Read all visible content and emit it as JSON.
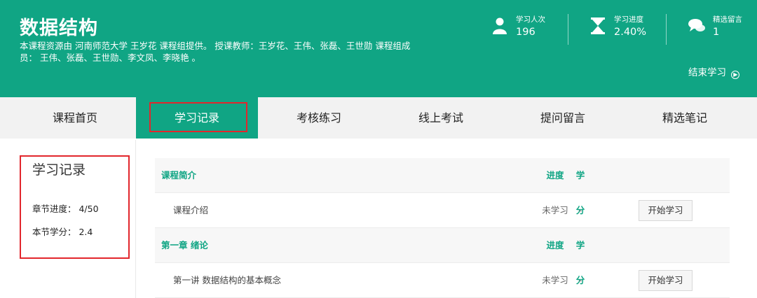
{
  "header": {
    "title": "数据结构",
    "description": "本课程资源由  河南师范大学  王岁花  课程组提供。    授课教师：王岁花、王伟、张磊、王世勋    课程组成员： 王伟、张磊、王世勋、李文凤、李晓艳 。",
    "stats": [
      {
        "label": "学习人次",
        "value": "196",
        "icon": "user-icon"
      },
      {
        "label": "学习进度",
        "value": "2.40%",
        "icon": "hourglass-icon"
      },
      {
        "label": "精选留言",
        "value": "1",
        "icon": "chat-bubbles-icon"
      }
    ],
    "end_study": "结束学习",
    "end_icon": "arrow-circle-icon"
  },
  "nav": {
    "tabs": [
      "课程首页",
      "学习记录",
      "考核练习",
      "线上考试",
      "提问留言",
      "精选笔记"
    ],
    "active": "学习记录"
  },
  "sidebar": {
    "title": "学习记录",
    "chapter_progress": "章节进度： 4/50",
    "section_credit": "本节学分： 2.4"
  },
  "table": {
    "rows": [
      {
        "type": "chapter",
        "name": "课程简介",
        "progress": "进度",
        "credit": "学分"
      },
      {
        "type": "lesson",
        "name": "课程介绍",
        "progress": "未学习",
        "credit": "-",
        "button": "开始学习"
      },
      {
        "type": "chapter",
        "name": "第一章 绪论",
        "progress": "进度",
        "credit": "学分"
      },
      {
        "type": "lesson",
        "name": "第一讲 数据结构的基本概念",
        "progress": "未学习",
        "credit": "-",
        "button": "开始学习"
      }
    ]
  },
  "colors": {
    "primary": "#10a584",
    "highlight": "#e2262c"
  }
}
